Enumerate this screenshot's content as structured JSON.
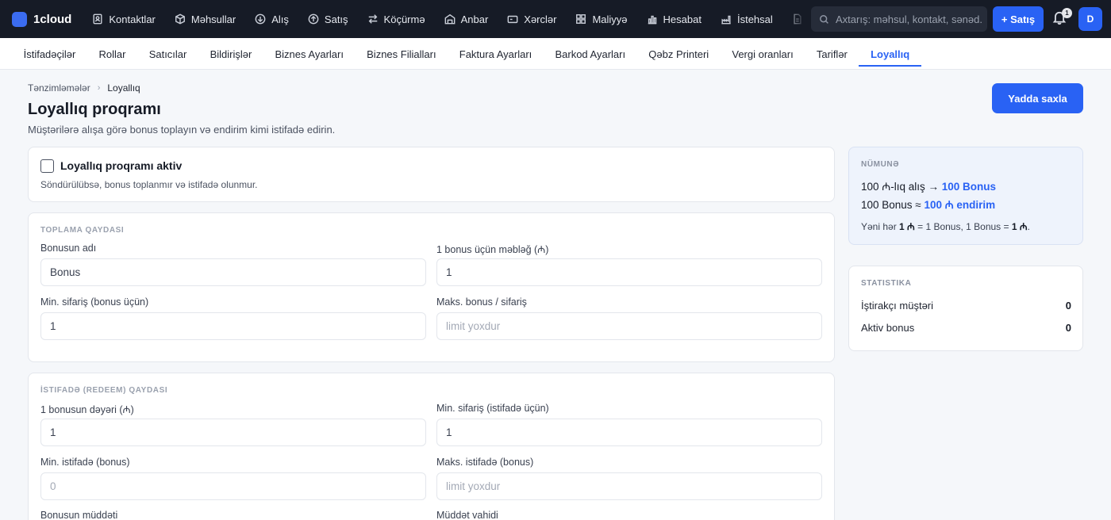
{
  "app": {
    "name": "1cloud"
  },
  "nav": {
    "items": [
      {
        "label": "Kontaktlar",
        "icon": "contacts-icon"
      },
      {
        "label": "Məhsullar",
        "icon": "box-icon"
      },
      {
        "label": "Alış",
        "icon": "arrow-down-circle-icon"
      },
      {
        "label": "Satış",
        "icon": "arrow-up-circle-icon"
      },
      {
        "label": "Köçürmə",
        "icon": "transfer-icon"
      },
      {
        "label": "Anbar",
        "icon": "warehouse-icon"
      },
      {
        "label": "Xərclər",
        "icon": "wallet-icon"
      },
      {
        "label": "Maliyyə",
        "icon": "grid-icon"
      },
      {
        "label": "Hesabat",
        "icon": "bar-chart-icon"
      },
      {
        "label": "İstehsal",
        "icon": "factory-icon"
      }
    ],
    "search_placeholder": "Axtarış: məhsul, kontakt, sənəd...",
    "new_sale_label": "+ Satış",
    "notification_count": "1",
    "avatar_initial": "D"
  },
  "subtabs": {
    "items": [
      "İstifadəçilər",
      "Rollar",
      "Satıcılar",
      "Bildirişlər",
      "Biznes Ayarları",
      "Biznes Filialları",
      "Faktura Ayarları",
      "Barkod Ayarları",
      "Qəbz Printeri",
      "Vergi oranları",
      "Tariflər",
      "Loyallıq"
    ],
    "active": "Loyallıq"
  },
  "breadcrumb": {
    "parent": "Tənzimləmələr",
    "current": "Loyallıq"
  },
  "page": {
    "title": "Loyallıq proqramı",
    "subtitle": "Müştərilərə alışa görə bonus toplayın və endirim kimi istifadə edirin.",
    "save_label": "Yadda saxla"
  },
  "toggle": {
    "label": "Loyallıq proqramı aktiv",
    "hint": "Söndürülübsə, bonus toplanmır və istifadə olunmur.",
    "checked": false
  },
  "accrual": {
    "section_title": "Toplama qaydası",
    "bonus_name": {
      "label": "Bonusun adı",
      "value": "Bonus",
      "placeholder": ""
    },
    "amount_per_bonus": {
      "label": "1 bonus üçün məbləğ (₼)",
      "value": "1",
      "placeholder": ""
    },
    "min_order": {
      "label": "Min. sifariş (bonus üçün)",
      "value": "1",
      "placeholder": ""
    },
    "max_bonus": {
      "label": "Maks. bonus / sifariş",
      "value": "",
      "placeholder": "limit yoxdur"
    }
  },
  "redeem": {
    "section_title": "İstifadə (redeem) qaydası",
    "bonus_value": {
      "label": "1 bonusun dəyəri (₼)",
      "value": "1",
      "placeholder": ""
    },
    "min_order": {
      "label": "Min. sifariş (istifadə üçün)",
      "value": "1",
      "placeholder": ""
    },
    "min_use": {
      "label": "Min. istifadə (bonus)",
      "value": "",
      "placeholder": "0"
    },
    "max_use": {
      "label": "Maks. istifadə (bonus)",
      "value": "",
      "placeholder": "limit yoxdur"
    },
    "duration": {
      "label": "Bonusun müddəti"
    },
    "duration_unit": {
      "label": "Müddət vahidi"
    }
  },
  "example": {
    "title": "Nümunə",
    "line1_prefix": "100 ₼-lıq alış → ",
    "line1_value": "100 Bonus",
    "line2_prefix": "100 Bonus ≈ ",
    "line2_value": "100 ₼ endirim",
    "note_prefix": "Yəni hər ",
    "note_amount": "1 ₼",
    "note_middle": " = 1 Bonus, 1 Bonus = ",
    "note_value": "1 ₼",
    "note_end": "."
  },
  "stats": {
    "title": "Statistika",
    "participants_label": "İştirakçı müştəri",
    "participants_value": "0",
    "active_bonus_label": "Aktiv bonus",
    "active_bonus_value": "0"
  }
}
